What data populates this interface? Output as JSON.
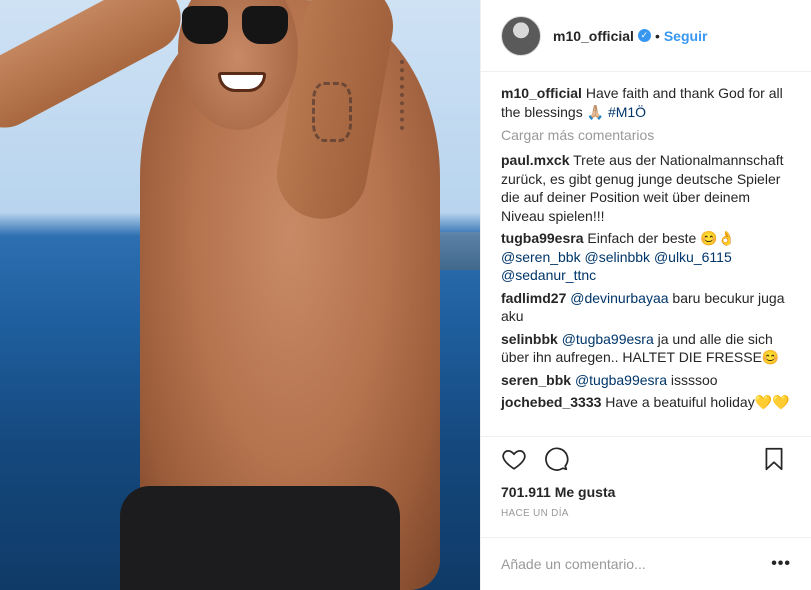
{
  "post": {
    "username": "m10_official",
    "follow_label": "Seguir",
    "separator": "•",
    "verified_glyph": "✓",
    "caption": {
      "text": "Have faith and thank God for all the blessings 🙏🏼",
      "hashtag": "#M1Ö"
    },
    "load_more": "Cargar más comentarios",
    "comments": [
      {
        "user": "paul.mxck",
        "parts": [
          {
            "t": "Trete aus der Nationalmannschaft zurück, es gibt genug junge deutsche Spieler die auf deiner Position weit über deinem Niveau spielen!!!"
          }
        ]
      },
      {
        "user": "tugba99esra",
        "parts": [
          {
            "t": "Einfach der beste 😊👌 "
          },
          {
            "tag": "@seren_bbk"
          },
          {
            "t": " "
          },
          {
            "tag": "@selinbbk"
          },
          {
            "t": " "
          },
          {
            "tag": "@ulku_6115"
          },
          {
            "t": " "
          },
          {
            "tag": "@sedanur_ttnc"
          }
        ]
      },
      {
        "user": "fadlimd27",
        "parts": [
          {
            "tag": "@devinurbayaa"
          },
          {
            "t": " baru becukur juga aku"
          }
        ]
      },
      {
        "user": "selinbbk",
        "parts": [
          {
            "tag": "@tugba99esra"
          },
          {
            "t": " ja und alle die sich über ihn aufregen.. HALTET DIE FRESSE😊"
          }
        ]
      },
      {
        "user": "seren_bbk",
        "parts": [
          {
            "tag": "@tugba99esra"
          },
          {
            "t": " issssoo"
          }
        ]
      },
      {
        "user": "jochebed_3333",
        "parts": [
          {
            "t": "Have a beatuiful holiday💛💛"
          }
        ]
      }
    ],
    "likes": "701.911 Me gusta",
    "time": "HACE UN DÍA",
    "add_comment_placeholder": "Añade un comentario...",
    "more_options": "•••"
  },
  "colors": {
    "link": "#3897f0",
    "muted": "#999999",
    "text": "#262626",
    "mention": "#003569"
  },
  "icons": [
    "heart-icon",
    "comment-icon",
    "bookmark-icon",
    "verified-icon",
    "more-options-icon"
  ]
}
